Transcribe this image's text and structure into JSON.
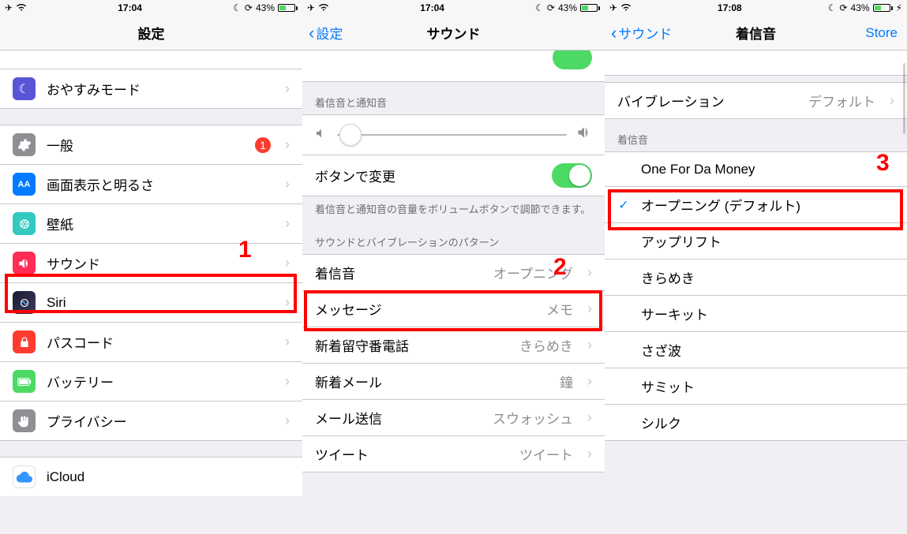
{
  "status": {
    "time1": "17:04",
    "time2": "17:04",
    "time3": "17:08",
    "battery": "43%"
  },
  "screen1": {
    "title": "設定",
    "items": {
      "partial_top": "",
      "dnd": "おやすみモード",
      "general": "一般",
      "general_badge": "1",
      "display": "画面表示と明るさ",
      "wallpaper": "壁紙",
      "sound": "サウンド",
      "siri": "Siri",
      "passcode": "パスコード",
      "battery": "バッテリー",
      "privacy": "プライバシー",
      "icloud": "iCloud"
    },
    "annot": "1"
  },
  "screen2": {
    "back": "設定",
    "title": "サウンド",
    "header1": "着信音と通知音",
    "change_with_buttons": "ボタンで変更",
    "footer1": "着信音と通知音の音量をボリュームボタンで調節できます。",
    "header2": "サウンドとバイブレーションのパターン",
    "rows": {
      "ringtone": {
        "label": "着信音",
        "value": "オープニング"
      },
      "message": {
        "label": "メッセージ",
        "value": "メモ"
      },
      "voicemail": {
        "label": "新着留守番電話",
        "value": "きらめき"
      },
      "newmail": {
        "label": "新着メール",
        "value": "鐘"
      },
      "sentmail": {
        "label": "メール送信",
        "value": "スウォッシュ"
      },
      "tweet": {
        "label": "ツイート",
        "value": "ツイート"
      }
    },
    "annot": "2"
  },
  "screen3": {
    "back": "サウンド",
    "title": "着信音",
    "store": "Store",
    "vibration": {
      "label": "バイブレーション",
      "value": "デフォルト"
    },
    "header": "着信音",
    "tones": [
      "One For Da Money",
      "オープニング (デフォルト)",
      "アップリフト",
      "きらめき",
      "サーキット",
      "さざ波",
      "サミット",
      "シルク"
    ],
    "selected_index": 1,
    "annot": "3"
  }
}
